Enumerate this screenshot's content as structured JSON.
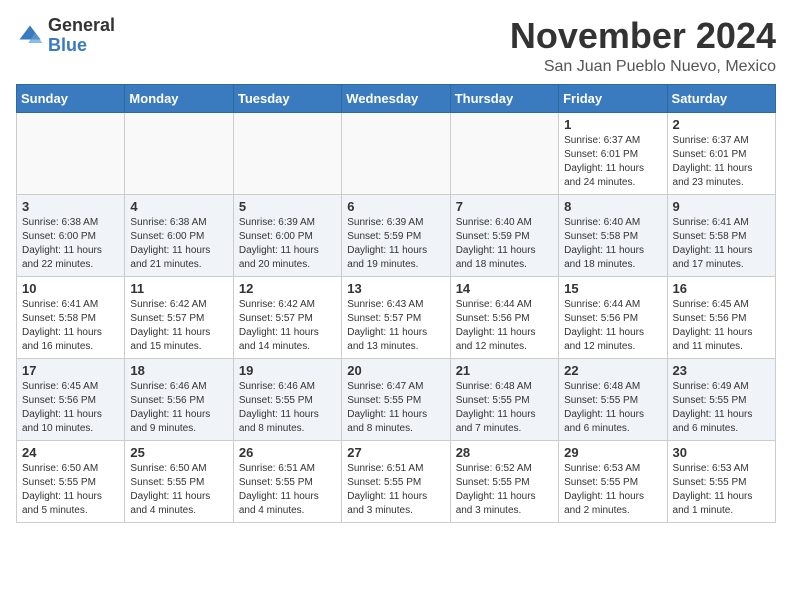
{
  "header": {
    "logo_general": "General",
    "logo_blue": "Blue",
    "month": "November 2024",
    "location": "San Juan Pueblo Nuevo, Mexico"
  },
  "days_of_week": [
    "Sunday",
    "Monday",
    "Tuesday",
    "Wednesday",
    "Thursday",
    "Friday",
    "Saturday"
  ],
  "weeks": [
    [
      {
        "day": "",
        "info": ""
      },
      {
        "day": "",
        "info": ""
      },
      {
        "day": "",
        "info": ""
      },
      {
        "day": "",
        "info": ""
      },
      {
        "day": "",
        "info": ""
      },
      {
        "day": "1",
        "info": "Sunrise: 6:37 AM\nSunset: 6:01 PM\nDaylight: 11 hours and 24 minutes."
      },
      {
        "day": "2",
        "info": "Sunrise: 6:37 AM\nSunset: 6:01 PM\nDaylight: 11 hours and 23 minutes."
      }
    ],
    [
      {
        "day": "3",
        "info": "Sunrise: 6:38 AM\nSunset: 6:00 PM\nDaylight: 11 hours and 22 minutes."
      },
      {
        "day": "4",
        "info": "Sunrise: 6:38 AM\nSunset: 6:00 PM\nDaylight: 11 hours and 21 minutes."
      },
      {
        "day": "5",
        "info": "Sunrise: 6:39 AM\nSunset: 6:00 PM\nDaylight: 11 hours and 20 minutes."
      },
      {
        "day": "6",
        "info": "Sunrise: 6:39 AM\nSunset: 5:59 PM\nDaylight: 11 hours and 19 minutes."
      },
      {
        "day": "7",
        "info": "Sunrise: 6:40 AM\nSunset: 5:59 PM\nDaylight: 11 hours and 18 minutes."
      },
      {
        "day": "8",
        "info": "Sunrise: 6:40 AM\nSunset: 5:58 PM\nDaylight: 11 hours and 18 minutes."
      },
      {
        "day": "9",
        "info": "Sunrise: 6:41 AM\nSunset: 5:58 PM\nDaylight: 11 hours and 17 minutes."
      }
    ],
    [
      {
        "day": "10",
        "info": "Sunrise: 6:41 AM\nSunset: 5:58 PM\nDaylight: 11 hours and 16 minutes."
      },
      {
        "day": "11",
        "info": "Sunrise: 6:42 AM\nSunset: 5:57 PM\nDaylight: 11 hours and 15 minutes."
      },
      {
        "day": "12",
        "info": "Sunrise: 6:42 AM\nSunset: 5:57 PM\nDaylight: 11 hours and 14 minutes."
      },
      {
        "day": "13",
        "info": "Sunrise: 6:43 AM\nSunset: 5:57 PM\nDaylight: 11 hours and 13 minutes."
      },
      {
        "day": "14",
        "info": "Sunrise: 6:44 AM\nSunset: 5:56 PM\nDaylight: 11 hours and 12 minutes."
      },
      {
        "day": "15",
        "info": "Sunrise: 6:44 AM\nSunset: 5:56 PM\nDaylight: 11 hours and 12 minutes."
      },
      {
        "day": "16",
        "info": "Sunrise: 6:45 AM\nSunset: 5:56 PM\nDaylight: 11 hours and 11 minutes."
      }
    ],
    [
      {
        "day": "17",
        "info": "Sunrise: 6:45 AM\nSunset: 5:56 PM\nDaylight: 11 hours and 10 minutes."
      },
      {
        "day": "18",
        "info": "Sunrise: 6:46 AM\nSunset: 5:56 PM\nDaylight: 11 hours and 9 minutes."
      },
      {
        "day": "19",
        "info": "Sunrise: 6:46 AM\nSunset: 5:55 PM\nDaylight: 11 hours and 8 minutes."
      },
      {
        "day": "20",
        "info": "Sunrise: 6:47 AM\nSunset: 5:55 PM\nDaylight: 11 hours and 8 minutes."
      },
      {
        "day": "21",
        "info": "Sunrise: 6:48 AM\nSunset: 5:55 PM\nDaylight: 11 hours and 7 minutes."
      },
      {
        "day": "22",
        "info": "Sunrise: 6:48 AM\nSunset: 5:55 PM\nDaylight: 11 hours and 6 minutes."
      },
      {
        "day": "23",
        "info": "Sunrise: 6:49 AM\nSunset: 5:55 PM\nDaylight: 11 hours and 6 minutes."
      }
    ],
    [
      {
        "day": "24",
        "info": "Sunrise: 6:50 AM\nSunset: 5:55 PM\nDaylight: 11 hours and 5 minutes."
      },
      {
        "day": "25",
        "info": "Sunrise: 6:50 AM\nSunset: 5:55 PM\nDaylight: 11 hours and 4 minutes."
      },
      {
        "day": "26",
        "info": "Sunrise: 6:51 AM\nSunset: 5:55 PM\nDaylight: 11 hours and 4 minutes."
      },
      {
        "day": "27",
        "info": "Sunrise: 6:51 AM\nSunset: 5:55 PM\nDaylight: 11 hours and 3 minutes."
      },
      {
        "day": "28",
        "info": "Sunrise: 6:52 AM\nSunset: 5:55 PM\nDaylight: 11 hours and 3 minutes."
      },
      {
        "day": "29",
        "info": "Sunrise: 6:53 AM\nSunset: 5:55 PM\nDaylight: 11 hours and 2 minutes."
      },
      {
        "day": "30",
        "info": "Sunrise: 6:53 AM\nSunset: 5:55 PM\nDaylight: 11 hours and 1 minute."
      }
    ]
  ]
}
